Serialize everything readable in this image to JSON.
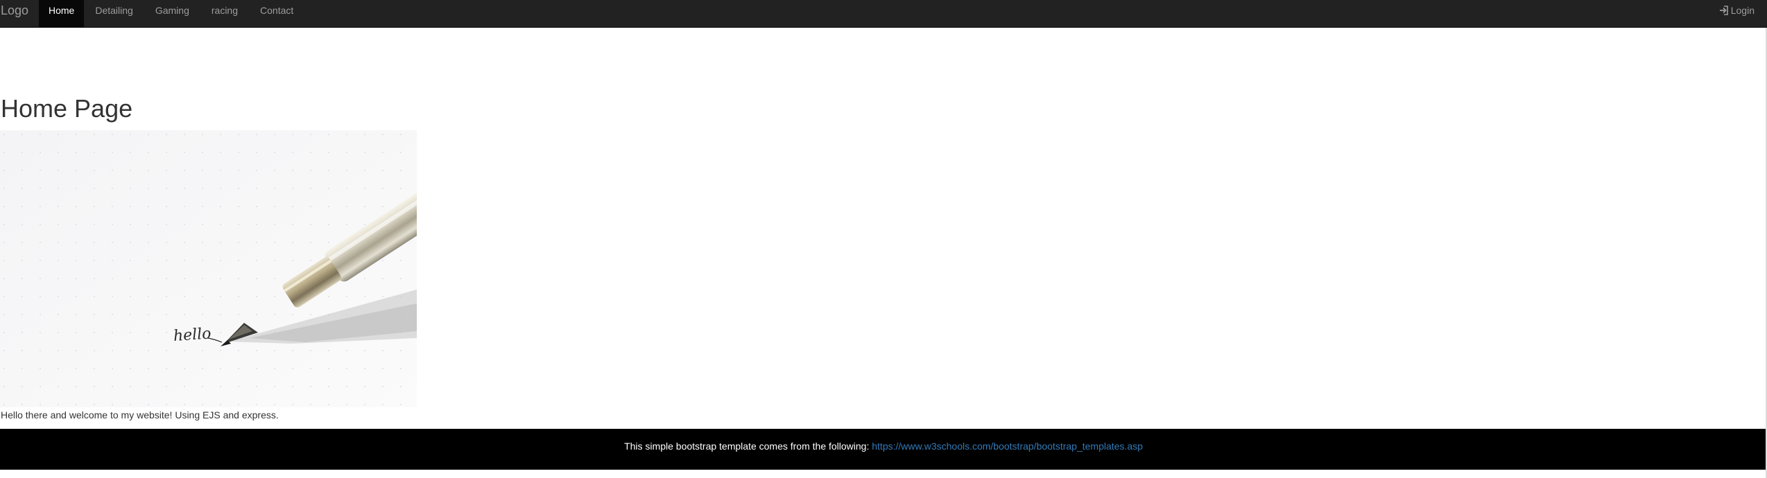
{
  "navbar": {
    "brand": "Logo",
    "items": [
      {
        "label": "Home",
        "active": true
      },
      {
        "label": "Detailing",
        "active": false
      },
      {
        "label": "Gaming",
        "active": false
      },
      {
        "label": "racing",
        "active": false
      },
      {
        "label": "Contact",
        "active": false
      }
    ],
    "login_label": "Login",
    "login_icon": "log-in-icon"
  },
  "main": {
    "title": "Home Page",
    "image_icon": "fountain-pen-writing-hello-image",
    "image_handwriting": "hello",
    "welcome_text": "Hello there and welcome to my website! Using EJS and express."
  },
  "footer": {
    "text": "This simple bootstrap template comes from the following:",
    "link": "https://www.w3schools.com/bootstrap/bootstrap_templates.asp"
  },
  "colors": {
    "navbar_bg": "#222222",
    "nav_text": "#9d9d9d",
    "nav_active_bg": "#080808",
    "footer_bg": "#000000",
    "link": "#337ab7"
  }
}
